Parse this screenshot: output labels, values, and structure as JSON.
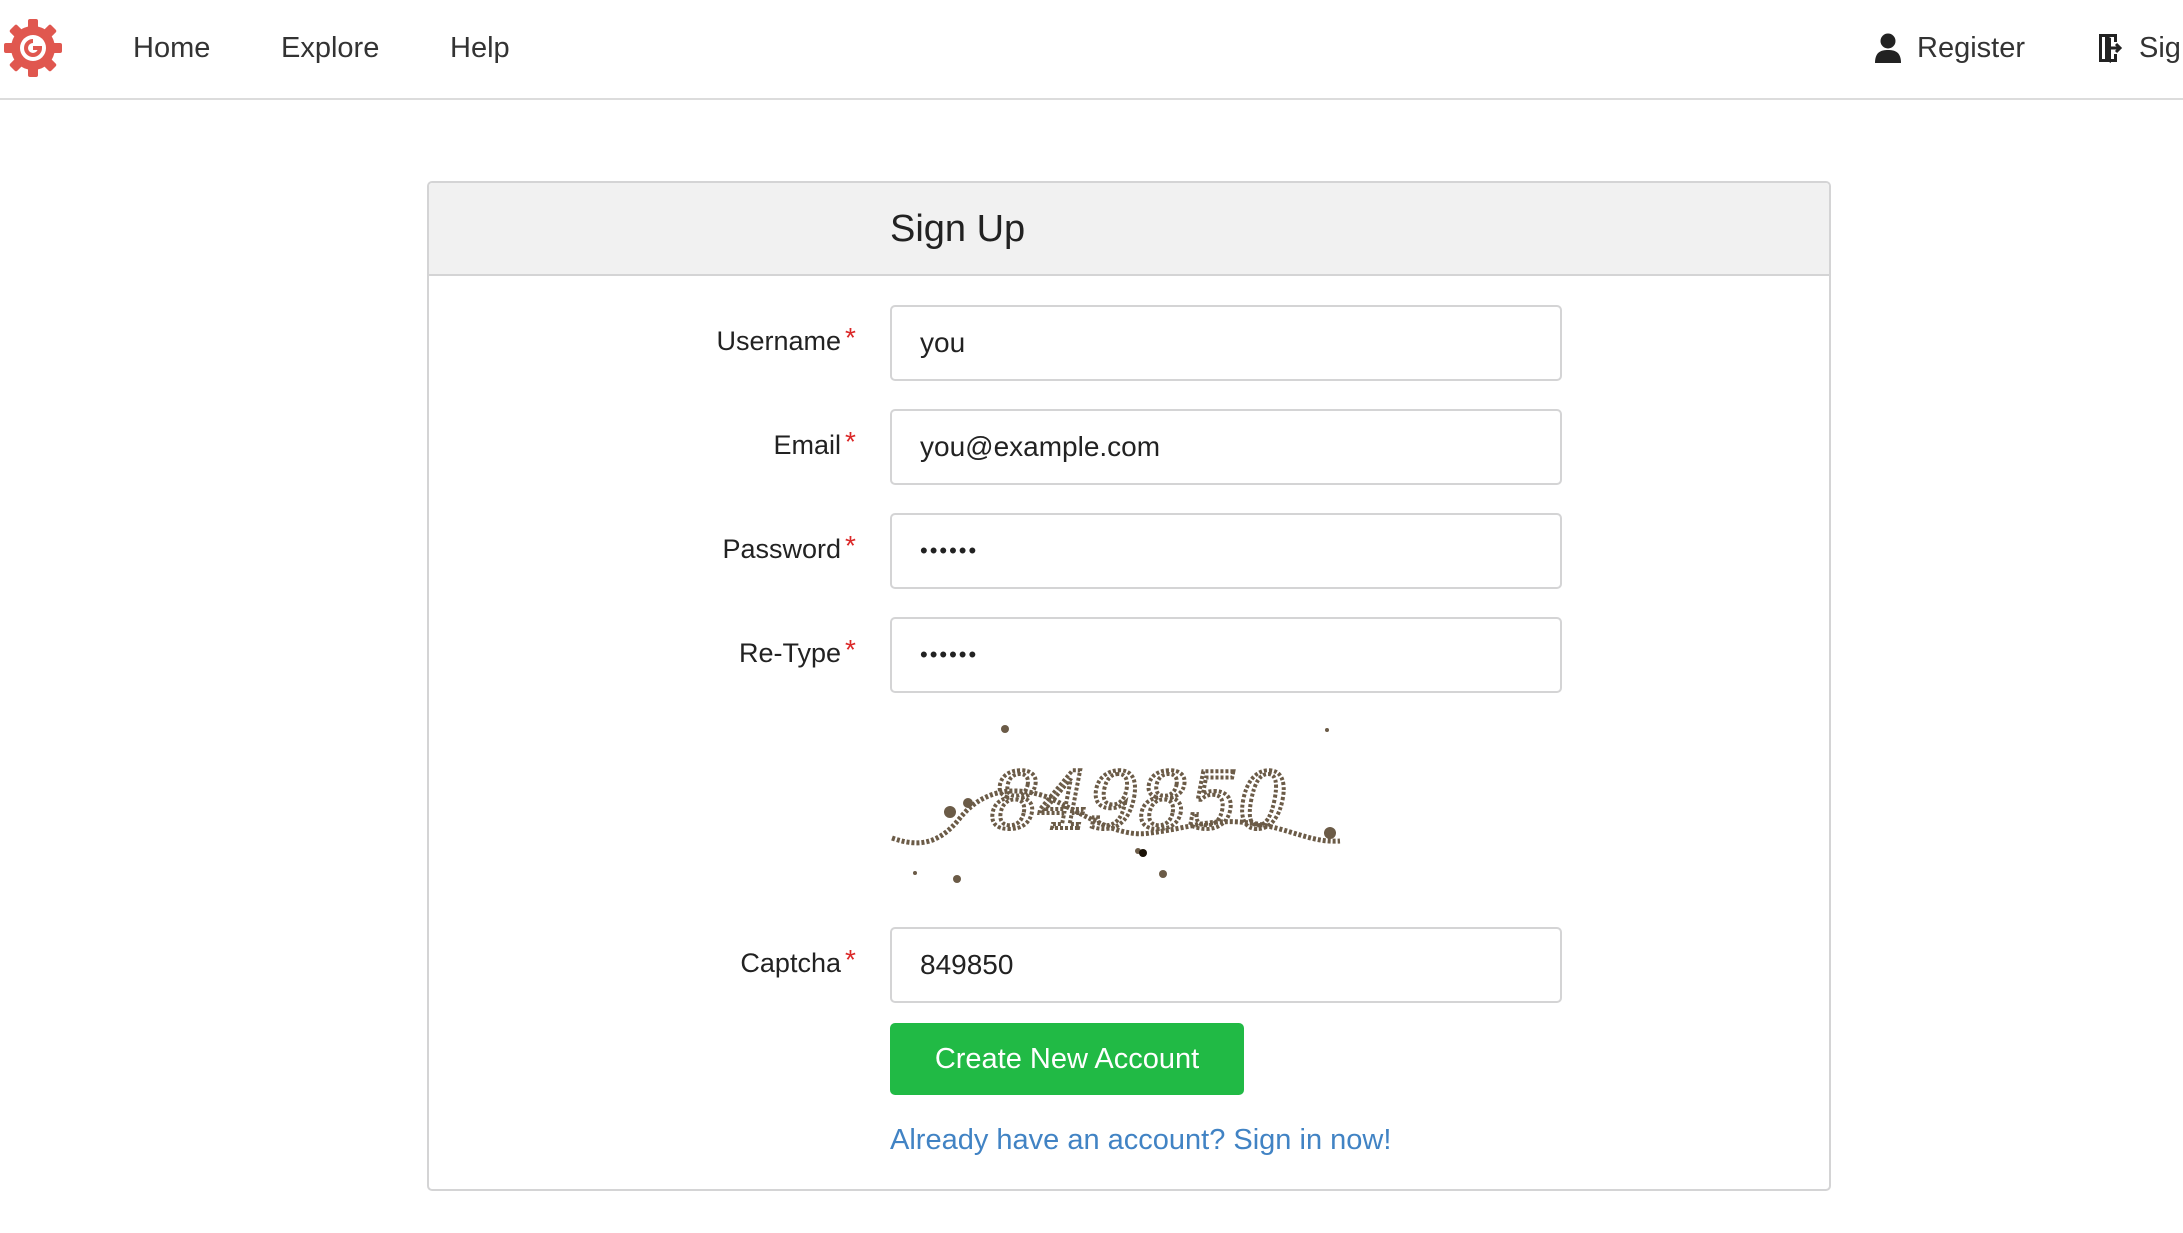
{
  "nav": {
    "logo_icon": "gear-logo-icon",
    "items": [
      {
        "label": "Home"
      },
      {
        "label": "Explore"
      },
      {
        "label": "Help"
      }
    ],
    "register_label": "Register",
    "register_icon": "user-icon",
    "signin_label": "Sig",
    "signin_icon": "sign-in-icon"
  },
  "form": {
    "title": "Sign Up",
    "required_marker": "*",
    "username": {
      "label": "Username",
      "value": "you"
    },
    "email": {
      "label": "Email",
      "value": "you@example.com"
    },
    "password": {
      "label": "Password",
      "masked": "••••••"
    },
    "retype": {
      "label": "Re-Type",
      "masked": "••••••"
    },
    "captcha_image_text": "849850",
    "captcha": {
      "label": "Captcha",
      "value": "849850"
    },
    "submit_label": "Create New Account",
    "signin_link": "Already have an account? Sign in now!"
  },
  "colors": {
    "accent_green": "#21ba45",
    "link_blue": "#4183c4",
    "required_red": "#db2828",
    "logo_red": "#e0574f"
  }
}
